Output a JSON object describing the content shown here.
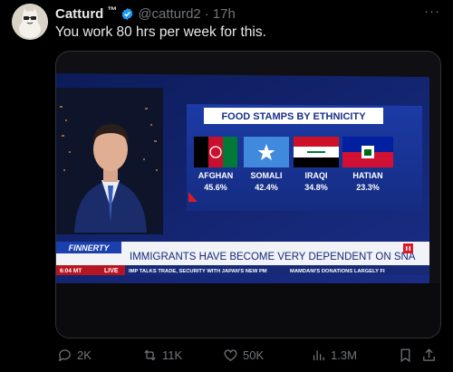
{
  "tweet": {
    "display_name": "Catturd",
    "tm": "™",
    "handle": "@catturd2",
    "separator": "·",
    "time": "17h",
    "text": "You work 80 hrs per week for this.",
    "more": "···"
  },
  "image": {
    "chart_title": "FOOD STAMPS BY ETHNICITY",
    "groups": [
      {
        "name": "AFGHAN",
        "value": "45.6%",
        "flag": "afghanistan-flag"
      },
      {
        "name": "SOMALI",
        "value": "42.4%",
        "flag": "somalia-flag"
      },
      {
        "name": "IRAQI",
        "value": "34.8%",
        "flag": "iraq-flag"
      },
      {
        "name": "HATIAN",
        "value": "23.3%",
        "flag": "haiti-flag"
      }
    ],
    "show_name": "FINNERTY",
    "headline": "IMMIGRANTS HAVE BECOME VERY DEPENDENT ON SNA",
    "clock": "6:04 MT",
    "live": "LIVE",
    "ticker_left": "IMP TALKS TRADE, SECURITY WITH JAPAN'S NEW PM",
    "ticker_right": "MAMDANI'S DONATIONS LARGELY FI"
  },
  "actions": {
    "replies": "2K",
    "reposts": "11K",
    "likes": "50K",
    "views": "1.3M"
  },
  "colors": {
    "accent_blue": "#1d9bf0",
    "muted": "#71767b",
    "text": "#e7e9ea"
  }
}
